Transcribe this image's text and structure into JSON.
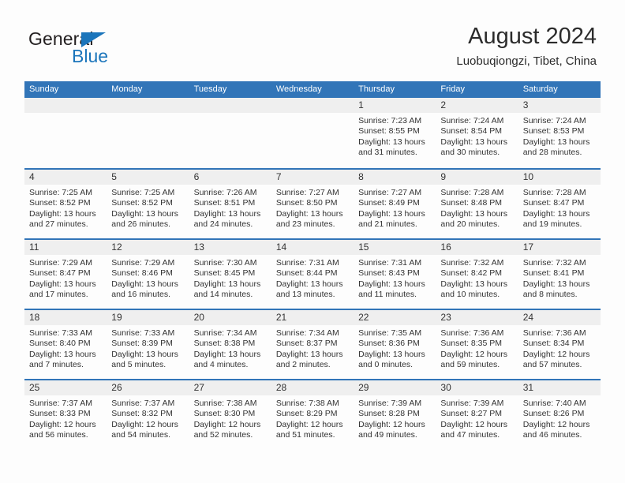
{
  "brand": {
    "name_top": "General",
    "name_bottom": "Blue",
    "triangle_color": "#1b75bb",
    "icon": "triangle-icon"
  },
  "header": {
    "title": "August 2024",
    "subtitle": "Luobuqiongzi, Tibet, China"
  },
  "theme": {
    "header_blue": "#3275b8",
    "daynum_gray": "#efefef",
    "text": "#333333",
    "page_bg": "#fdfdfd"
  },
  "calendar": {
    "weekdays": [
      "Sunday",
      "Monday",
      "Tuesday",
      "Wednesday",
      "Thursday",
      "Friday",
      "Saturday"
    ],
    "weeks": [
      [
        {
          "day": "",
          "sunrise": "",
          "sunset": "",
          "daylight": "",
          "daylight2": ""
        },
        {
          "day": "",
          "sunrise": "",
          "sunset": "",
          "daylight": "",
          "daylight2": ""
        },
        {
          "day": "",
          "sunrise": "",
          "sunset": "",
          "daylight": "",
          "daylight2": ""
        },
        {
          "day": "",
          "sunrise": "",
          "sunset": "",
          "daylight": "",
          "daylight2": ""
        },
        {
          "day": "1",
          "sunrise": "Sunrise: 7:23 AM",
          "sunset": "Sunset: 8:55 PM",
          "daylight": "Daylight: 13 hours",
          "daylight2": "and 31 minutes."
        },
        {
          "day": "2",
          "sunrise": "Sunrise: 7:24 AM",
          "sunset": "Sunset: 8:54 PM",
          "daylight": "Daylight: 13 hours",
          "daylight2": "and 30 minutes."
        },
        {
          "day": "3",
          "sunrise": "Sunrise: 7:24 AM",
          "sunset": "Sunset: 8:53 PM",
          "daylight": "Daylight: 13 hours",
          "daylight2": "and 28 minutes."
        }
      ],
      [
        {
          "day": "4",
          "sunrise": "Sunrise: 7:25 AM",
          "sunset": "Sunset: 8:52 PM",
          "daylight": "Daylight: 13 hours",
          "daylight2": "and 27 minutes."
        },
        {
          "day": "5",
          "sunrise": "Sunrise: 7:25 AM",
          "sunset": "Sunset: 8:52 PM",
          "daylight": "Daylight: 13 hours",
          "daylight2": "and 26 minutes."
        },
        {
          "day": "6",
          "sunrise": "Sunrise: 7:26 AM",
          "sunset": "Sunset: 8:51 PM",
          "daylight": "Daylight: 13 hours",
          "daylight2": "and 24 minutes."
        },
        {
          "day": "7",
          "sunrise": "Sunrise: 7:27 AM",
          "sunset": "Sunset: 8:50 PM",
          "daylight": "Daylight: 13 hours",
          "daylight2": "and 23 minutes."
        },
        {
          "day": "8",
          "sunrise": "Sunrise: 7:27 AM",
          "sunset": "Sunset: 8:49 PM",
          "daylight": "Daylight: 13 hours",
          "daylight2": "and 21 minutes."
        },
        {
          "day": "9",
          "sunrise": "Sunrise: 7:28 AM",
          "sunset": "Sunset: 8:48 PM",
          "daylight": "Daylight: 13 hours",
          "daylight2": "and 20 minutes."
        },
        {
          "day": "10",
          "sunrise": "Sunrise: 7:28 AM",
          "sunset": "Sunset: 8:47 PM",
          "daylight": "Daylight: 13 hours",
          "daylight2": "and 19 minutes."
        }
      ],
      [
        {
          "day": "11",
          "sunrise": "Sunrise: 7:29 AM",
          "sunset": "Sunset: 8:47 PM",
          "daylight": "Daylight: 13 hours",
          "daylight2": "and 17 minutes."
        },
        {
          "day": "12",
          "sunrise": "Sunrise: 7:29 AM",
          "sunset": "Sunset: 8:46 PM",
          "daylight": "Daylight: 13 hours",
          "daylight2": "and 16 minutes."
        },
        {
          "day": "13",
          "sunrise": "Sunrise: 7:30 AM",
          "sunset": "Sunset: 8:45 PM",
          "daylight": "Daylight: 13 hours",
          "daylight2": "and 14 minutes."
        },
        {
          "day": "14",
          "sunrise": "Sunrise: 7:31 AM",
          "sunset": "Sunset: 8:44 PM",
          "daylight": "Daylight: 13 hours",
          "daylight2": "and 13 minutes."
        },
        {
          "day": "15",
          "sunrise": "Sunrise: 7:31 AM",
          "sunset": "Sunset: 8:43 PM",
          "daylight": "Daylight: 13 hours",
          "daylight2": "and 11 minutes."
        },
        {
          "day": "16",
          "sunrise": "Sunrise: 7:32 AM",
          "sunset": "Sunset: 8:42 PM",
          "daylight": "Daylight: 13 hours",
          "daylight2": "and 10 minutes."
        },
        {
          "day": "17",
          "sunrise": "Sunrise: 7:32 AM",
          "sunset": "Sunset: 8:41 PM",
          "daylight": "Daylight: 13 hours",
          "daylight2": "and 8 minutes."
        }
      ],
      [
        {
          "day": "18",
          "sunrise": "Sunrise: 7:33 AM",
          "sunset": "Sunset: 8:40 PM",
          "daylight": "Daylight: 13 hours",
          "daylight2": "and 7 minutes."
        },
        {
          "day": "19",
          "sunrise": "Sunrise: 7:33 AM",
          "sunset": "Sunset: 8:39 PM",
          "daylight": "Daylight: 13 hours",
          "daylight2": "and 5 minutes."
        },
        {
          "day": "20",
          "sunrise": "Sunrise: 7:34 AM",
          "sunset": "Sunset: 8:38 PM",
          "daylight": "Daylight: 13 hours",
          "daylight2": "and 4 minutes."
        },
        {
          "day": "21",
          "sunrise": "Sunrise: 7:34 AM",
          "sunset": "Sunset: 8:37 PM",
          "daylight": "Daylight: 13 hours",
          "daylight2": "and 2 minutes."
        },
        {
          "day": "22",
          "sunrise": "Sunrise: 7:35 AM",
          "sunset": "Sunset: 8:36 PM",
          "daylight": "Daylight: 13 hours",
          "daylight2": "and 0 minutes."
        },
        {
          "day": "23",
          "sunrise": "Sunrise: 7:36 AM",
          "sunset": "Sunset: 8:35 PM",
          "daylight": "Daylight: 12 hours",
          "daylight2": "and 59 minutes."
        },
        {
          "day": "24",
          "sunrise": "Sunrise: 7:36 AM",
          "sunset": "Sunset: 8:34 PM",
          "daylight": "Daylight: 12 hours",
          "daylight2": "and 57 minutes."
        }
      ],
      [
        {
          "day": "25",
          "sunrise": "Sunrise: 7:37 AM",
          "sunset": "Sunset: 8:33 PM",
          "daylight": "Daylight: 12 hours",
          "daylight2": "and 56 minutes."
        },
        {
          "day": "26",
          "sunrise": "Sunrise: 7:37 AM",
          "sunset": "Sunset: 8:32 PM",
          "daylight": "Daylight: 12 hours",
          "daylight2": "and 54 minutes."
        },
        {
          "day": "27",
          "sunrise": "Sunrise: 7:38 AM",
          "sunset": "Sunset: 8:30 PM",
          "daylight": "Daylight: 12 hours",
          "daylight2": "and 52 minutes."
        },
        {
          "day": "28",
          "sunrise": "Sunrise: 7:38 AM",
          "sunset": "Sunset: 8:29 PM",
          "daylight": "Daylight: 12 hours",
          "daylight2": "and 51 minutes."
        },
        {
          "day": "29",
          "sunrise": "Sunrise: 7:39 AM",
          "sunset": "Sunset: 8:28 PM",
          "daylight": "Daylight: 12 hours",
          "daylight2": "and 49 minutes."
        },
        {
          "day": "30",
          "sunrise": "Sunrise: 7:39 AM",
          "sunset": "Sunset: 8:27 PM",
          "daylight": "Daylight: 12 hours",
          "daylight2": "and 47 minutes."
        },
        {
          "day": "31",
          "sunrise": "Sunrise: 7:40 AM",
          "sunset": "Sunset: 8:26 PM",
          "daylight": "Daylight: 12 hours",
          "daylight2": "and 46 minutes."
        }
      ]
    ]
  }
}
